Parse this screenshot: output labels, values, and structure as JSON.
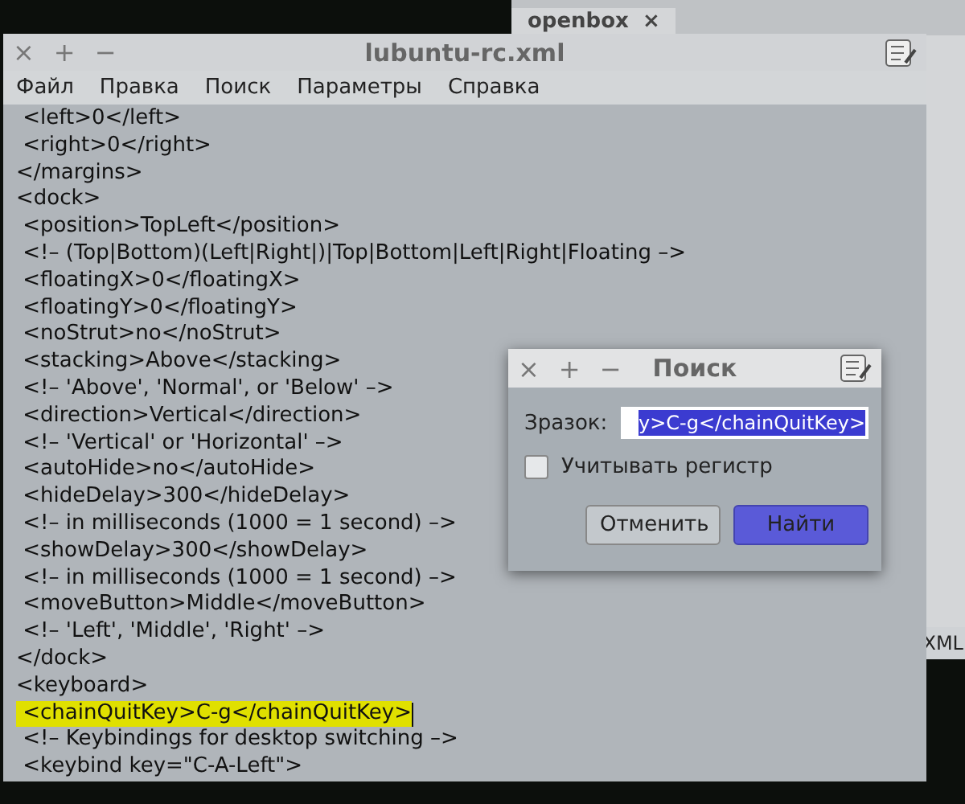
{
  "file_manager": {
    "tab": {
      "label": "openbox",
      "close": "×"
    },
    "status_bar": "XML"
  },
  "editor": {
    "controls": [
      "×",
      "+",
      "−"
    ],
    "title": "lubuntu-rc.xml",
    "menu": [
      "Файл",
      "Правка",
      "Поиск",
      "Параметры",
      "Справка"
    ],
    "lines": [
      {
        "text": " <left>0</left>",
        "highlighted": false
      },
      {
        "text": " <right>0</right>",
        "highlighted": false
      },
      {
        "text": "</margins>",
        "highlighted": false
      },
      {
        "text": "<dock>",
        "highlighted": false
      },
      {
        "text": " <position>TopLeft</position>",
        "highlighted": false
      },
      {
        "text": " <!– (Top|Bottom)(Left|Right|)|Top|Bottom|Left|Right|Floating –>",
        "highlighted": false
      },
      {
        "text": " <floatingX>0</floatingX>",
        "highlighted": false
      },
      {
        "text": " <floatingY>0</floatingY>",
        "highlighted": false
      },
      {
        "text": " <noStrut>no</noStrut>",
        "highlighted": false
      },
      {
        "text": " <stacking>Above</stacking>",
        "highlighted": false
      },
      {
        "text": " <!– 'Above', 'Normal', or 'Below' –>",
        "highlighted": false
      },
      {
        "text": " <direction>Vertical</direction>",
        "highlighted": false
      },
      {
        "text": " <!– 'Vertical' or 'Horizontal' –>",
        "highlighted": false
      },
      {
        "text": " <autoHide>no</autoHide>",
        "highlighted": false
      },
      {
        "text": " <hideDelay>300</hideDelay>",
        "highlighted": false
      },
      {
        "text": " <!– in milliseconds (1000 = 1 second) –>",
        "highlighted": false
      },
      {
        "text": " <showDelay>300</showDelay>",
        "highlighted": false
      },
      {
        "text": " <!– in milliseconds (1000 = 1 second) –>",
        "highlighted": false
      },
      {
        "text": " <moveButton>Middle</moveButton>",
        "highlighted": false
      },
      {
        "text": " <!– 'Left', 'Middle', 'Right' –>",
        "highlighted": false
      },
      {
        "text": "</dock>",
        "highlighted": false
      },
      {
        "text": "<keyboard>",
        "highlighted": false
      },
      {
        "text": " <chainQuitKey>C-g</chainQuitKey>",
        "highlighted": true
      },
      {
        "text": " <!– Keybindings for desktop switching –>",
        "highlighted": false
      },
      {
        "text": " <keybind key=\"C-A-Left\">",
        "highlighted": false
      }
    ]
  },
  "dialog": {
    "controls": [
      "×",
      "+",
      "−"
    ],
    "title": "Поиск",
    "label": "Зразок:",
    "value": "y>C-g</chainQuitKey>",
    "checkbox": {
      "label": "Учитывать регистр",
      "checked": false
    },
    "buttons": [
      {
        "label": "Отменить",
        "primary": false
      },
      {
        "label": "Найти",
        "primary": true
      }
    ]
  }
}
